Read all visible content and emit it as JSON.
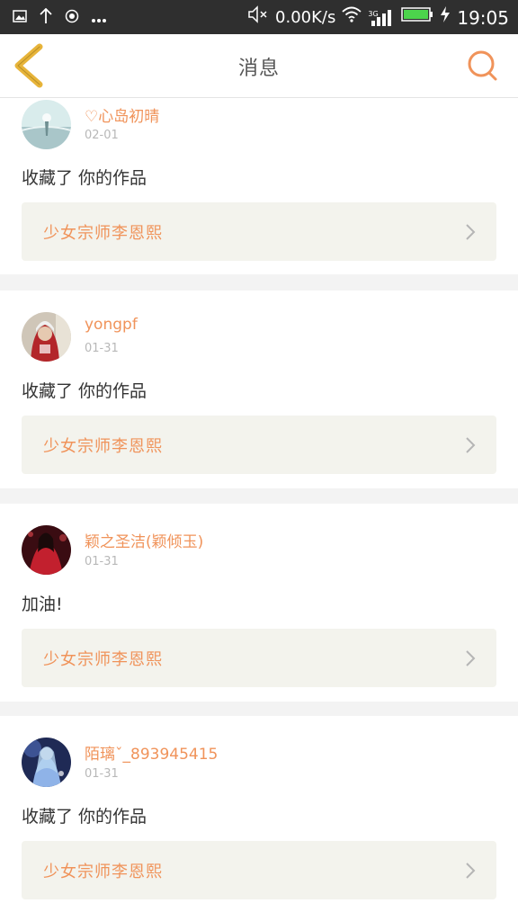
{
  "status_bar": {
    "net_speed": "0.00K/s",
    "network_type": "3G",
    "time": "19:05",
    "icons": [
      "image-icon",
      "upload-arrow-icon",
      "record-icon",
      "more-dots-icon",
      "mute-icon",
      "wifi-icon",
      "signal-icon",
      "battery-icon",
      "charging-icon"
    ]
  },
  "header": {
    "title": "消息",
    "back_icon": "chevron-left-icon",
    "search_icon": "search-icon"
  },
  "colors": {
    "accent": "#f0935a",
    "back_arrow": "#e7b43a",
    "card_link_bg": "#f3f3ed",
    "page_bg": "#f3f3f3"
  },
  "messages": [
    {
      "user": "♡心岛初晴",
      "date": "02-01",
      "text": "收藏了 你的作品",
      "work": "少女宗师李恩熙",
      "avatar": "avatar-sky-scene"
    },
    {
      "user": "yongpf",
      "date": "01-31",
      "text": "收藏了 你的作品",
      "work": "少女宗师李恩熙",
      "avatar": "avatar-red-hood"
    },
    {
      "user": "颖之圣洁(颖倾玉)",
      "date": "01-31",
      "text": "加油!",
      "work": "少女宗师李恩熙",
      "avatar": "avatar-red-dress"
    },
    {
      "user": "陌璃ˇ_893945415",
      "date": "01-31",
      "text": "收藏了 你的作品",
      "work": "少女宗师李恩熙",
      "avatar": "avatar-blue-fantasy"
    }
  ]
}
